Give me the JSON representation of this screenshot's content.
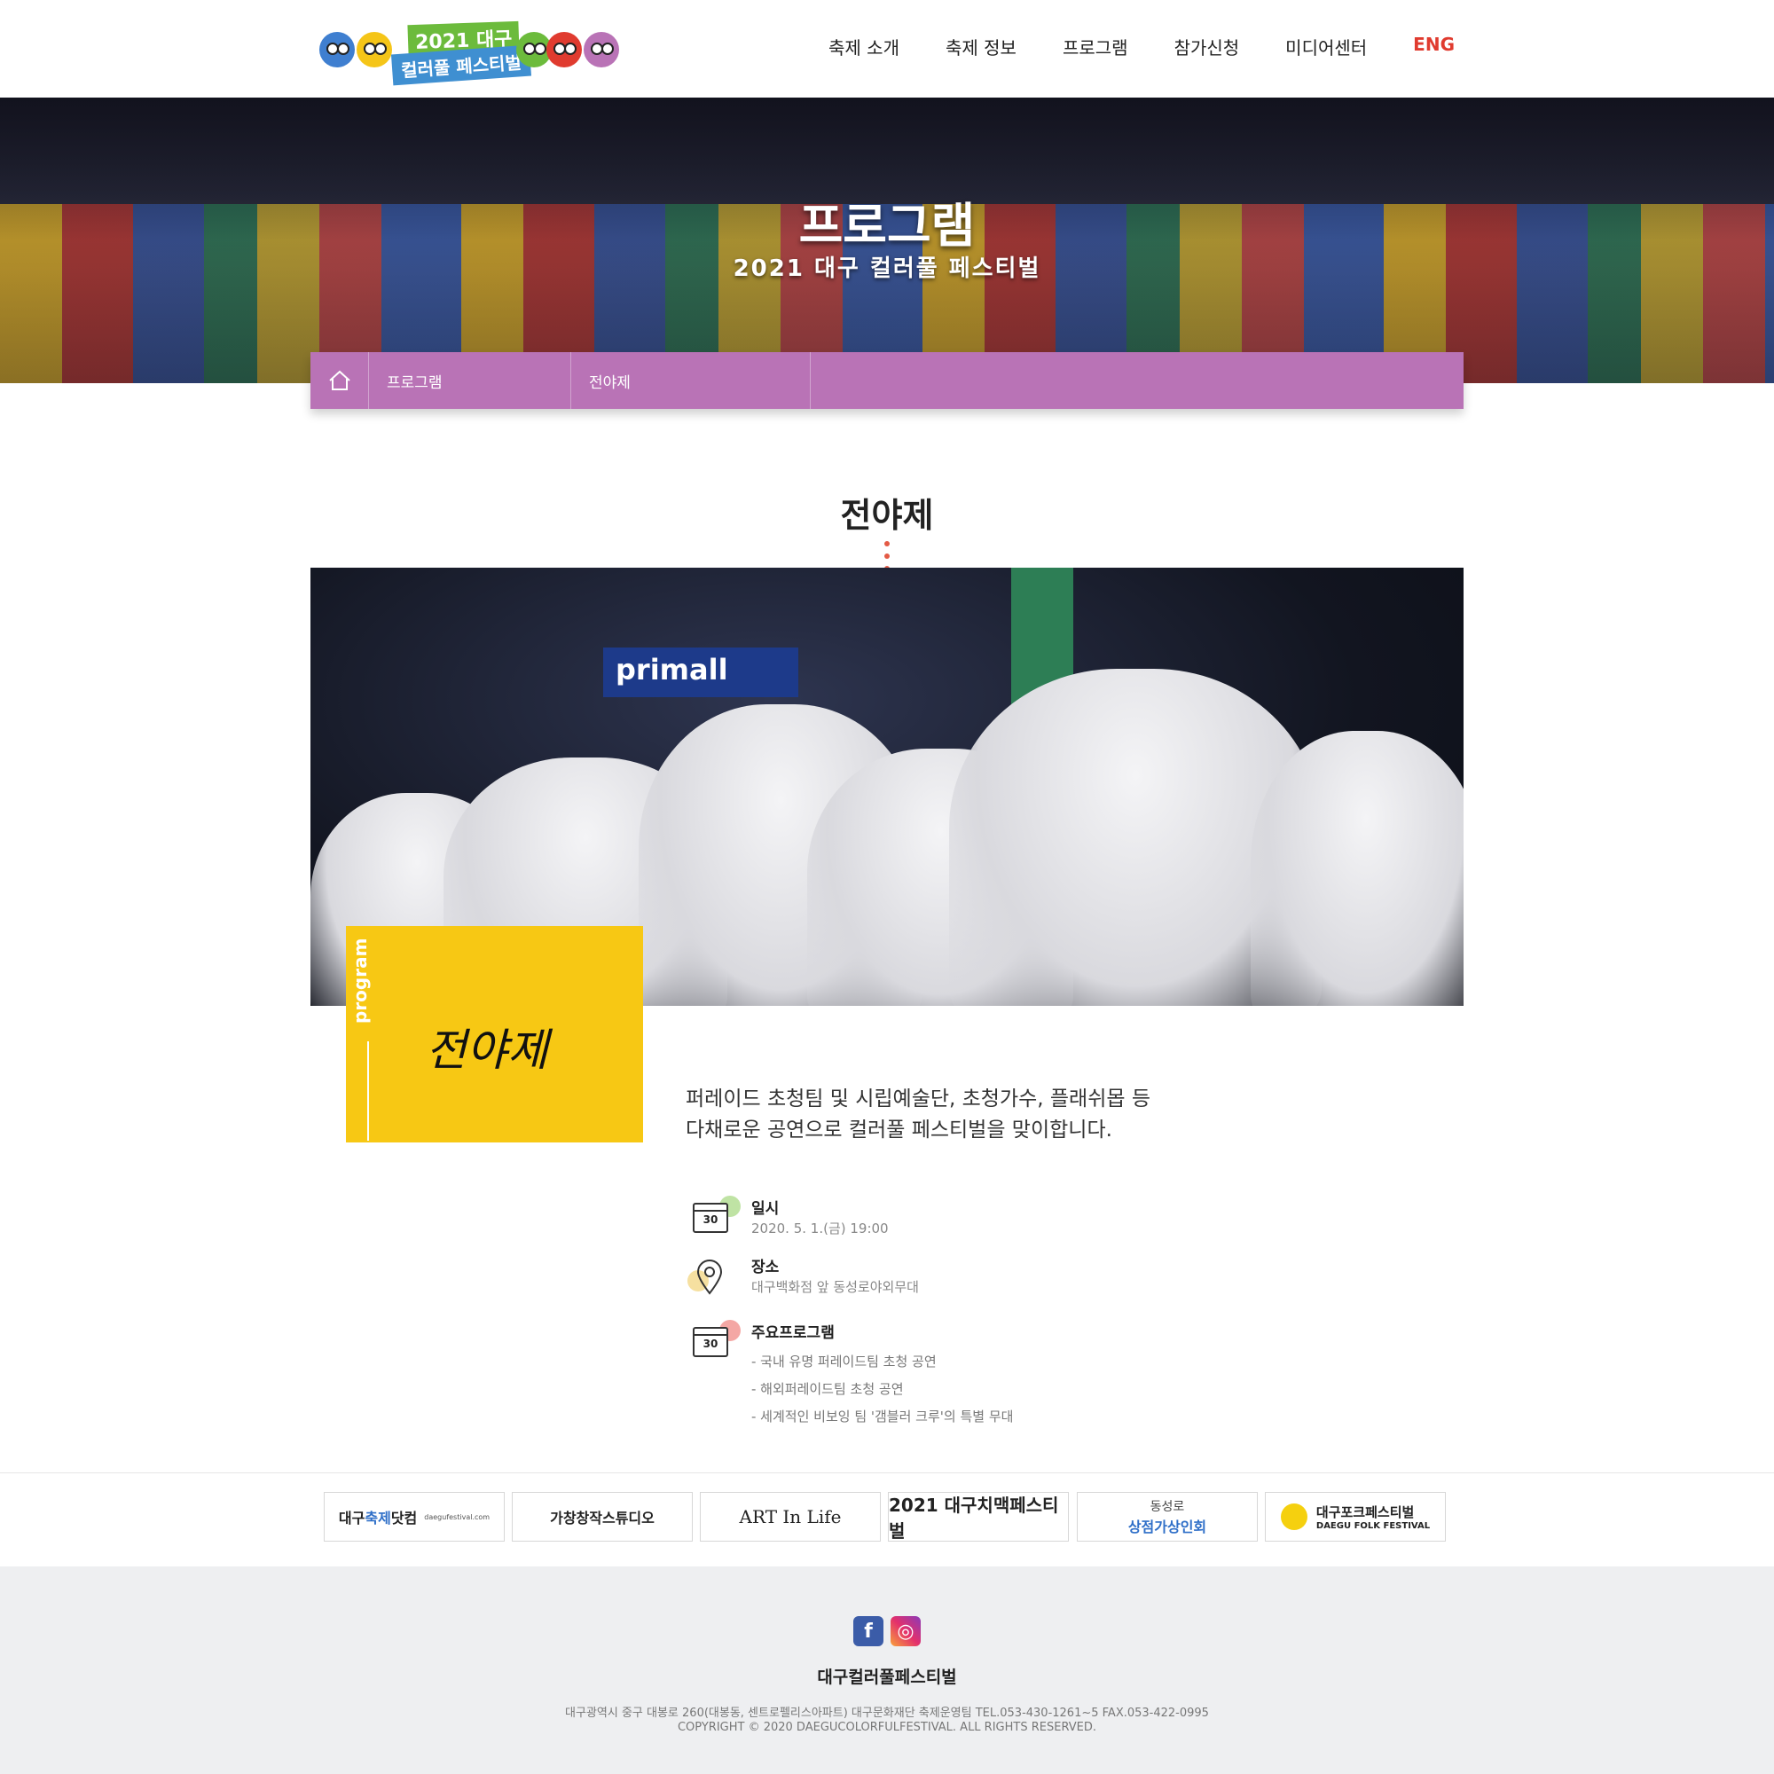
{
  "header": {
    "logo": {
      "year_text": "2021 대구",
      "name_text": "컬러풀 페스티벌",
      "dot_colors": [
        "#3f7fd0",
        "#f5c518",
        "#6cbb3c",
        "#e03b2f",
        "#b973b6"
      ]
    },
    "nav": [
      {
        "label": "축제 소개"
      },
      {
        "label": "축제 정보"
      },
      {
        "label": "프로그램"
      },
      {
        "label": "참가신청"
      },
      {
        "label": "미디어센터"
      },
      {
        "label": "ENG"
      }
    ]
  },
  "hero": {
    "title": "프로그램",
    "subtitle": "2021 대구 컬러풀 페스티벌"
  },
  "breadcrumb": {
    "home_icon": "home-icon",
    "items": [
      "프로그램",
      "전야제"
    ]
  },
  "section": {
    "title": "전야제",
    "photo_sign": "primall",
    "tag": "program",
    "script_title": "전야제",
    "description_line1": "퍼레이드 초청팀 및 시립예술단, 초청가수, 플래쉬몹 등",
    "description_line2": "다채로운 공연으로 컬러풀 페스티벌을 맞이합니다.",
    "info": {
      "date": {
        "label": "일시",
        "value": "2020. 5. 1.(금) 19:00",
        "icon_text": "30"
      },
      "place": {
        "label": "장소",
        "value": "대구백화점 앞 동성로야외무대"
      },
      "program": {
        "label": "주요프로그램",
        "icon_text": "30",
        "items": [
          "- 국내 유명 퍼레이드팀 초청 공연",
          "- 해외퍼레이드팀 초청 공연",
          "- 세계적인 비보잉 팀 '갬블러 크루'의 특별 무대"
        ]
      }
    }
  },
  "partners": [
    {
      "name_a": "대구",
      "name_b": "축제",
      "name_c": "닷컴",
      "sub": "daegufestival.com"
    },
    {
      "name": "가창창작스튜디오"
    },
    {
      "name": "ART In Life"
    },
    {
      "name": "2021 대구치맥페스티벌"
    },
    {
      "line1": "동성로",
      "line2": "상점가상인회"
    },
    {
      "line1": "대구포크페스티벌",
      "line2": "DAEGU FOLK FESTIVAL"
    }
  ],
  "footer": {
    "social": [
      {
        "icon": "facebook-icon",
        "glyph": "f"
      },
      {
        "icon": "instagram-icon",
        "glyph": "◎"
      }
    ],
    "title": "대구컬러풀페스티벌",
    "address": "대구광역시 중구 대봉로 260(대봉동, 센트로펠리스아파트) 대구문화재단 축제운영팀 TEL.053-430-1261~5 FAX.053-422-0995",
    "copyright": "COPYRIGHT © 2020 DAEGUCOLORFULFESTIVAL. ALL RIGHTS RESERVED."
  },
  "colors": {
    "accent_purple": "#b973b6",
    "accent_yellow": "#f7c814",
    "eng_red": "#e03b2f",
    "footer_bg": "#eeeff1"
  }
}
